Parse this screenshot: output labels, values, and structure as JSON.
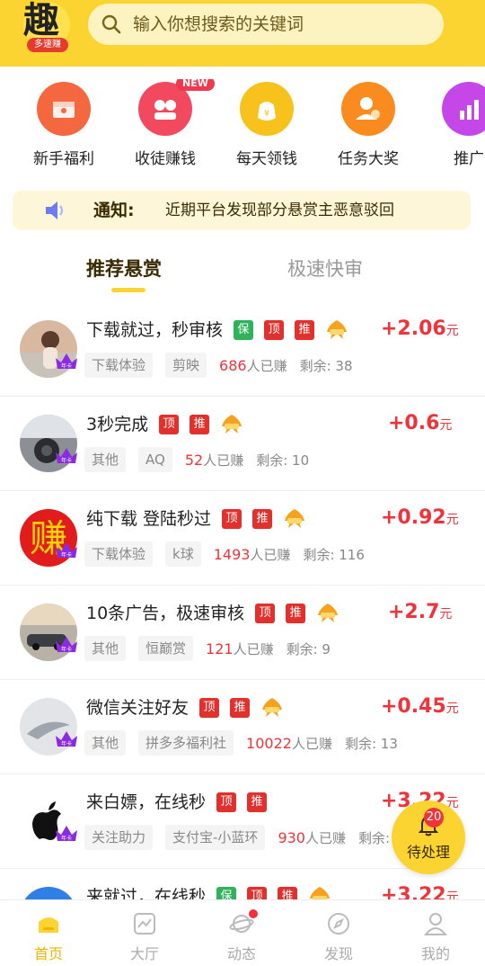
{
  "header": {
    "logo_char": "趣",
    "logo_sub": "多速赚",
    "search_placeholder": "输入你想搜索的关键词"
  },
  "quick_menu": [
    {
      "label": "新手福利",
      "icon": "gift-envelope-icon",
      "color": "#f5673e"
    },
    {
      "label": "收徒赚钱",
      "icon": "money-people-icon",
      "color": "#f2495e",
      "badge": "NEW"
    },
    {
      "label": "每天领钱",
      "icon": "money-bag-icon",
      "color": "#f8c21c"
    },
    {
      "label": "任务大奖",
      "icon": "reward-person-icon",
      "color": "#fa8c1f"
    },
    {
      "label": "推广",
      "icon": "promotion-chart-icon",
      "color": "#c647e8"
    }
  ],
  "notice": {
    "title": "通知:",
    "text": "近期平台发现部分悬赏主恶意驳回"
  },
  "tabs": {
    "active": "推荐悬赏",
    "inactive": "极速快审"
  },
  "tag_labels": {
    "bao": "保",
    "top": "顶",
    "rec": "推"
  },
  "earned_suffix": "人已赚",
  "remain_prefix": "剩余: ",
  "tasks": [
    {
      "title": "下载就过，秒审核",
      "tags": [
        "bao",
        "top",
        "rec",
        "hot"
      ],
      "amount": "+2.06",
      "unit": "元",
      "chips": [
        "下载体验",
        "剪映"
      ],
      "earned": "686",
      "remain": "38",
      "avatar": "photo-girl"
    },
    {
      "title": "3秒完成",
      "tags": [
        "top",
        "rec",
        "hot"
      ],
      "amount": "+0.6",
      "unit": "元",
      "chips": [
        "其他",
        "AQ"
      ],
      "earned": "52",
      "remain": "10",
      "avatar": "car-interior"
    },
    {
      "title": "纯下载  登陆秒过",
      "tags": [
        "top",
        "rec",
        "hot"
      ],
      "amount": "+0.92",
      "unit": "元",
      "chips": [
        "下载体验",
        "k球"
      ],
      "earned": "1493",
      "remain": "116",
      "avatar": "zhuan-char"
    },
    {
      "title": "10条广告，极速审核",
      "tags": [
        "top",
        "rec",
        "hot"
      ],
      "amount": "+2.7",
      "unit": "元",
      "chips": [
        "其他",
        "恒巅赏"
      ],
      "earned": "121",
      "remain": "9",
      "avatar": "car-photo"
    },
    {
      "title": "微信关注好友",
      "tags": [
        "top",
        "rec",
        "hot"
      ],
      "amount": "+0.45",
      "unit": "元",
      "chips": [
        "其他",
        "拼多多福利社"
      ],
      "earned": "10022",
      "remain": "13",
      "avatar": "shark-photo"
    },
    {
      "title": "来白嫖，在线秒",
      "tags": [
        "top",
        "rec"
      ],
      "amount": "+3.22",
      "unit": "元",
      "chips": [
        "关注助力",
        "支付宝-小蓝环"
      ],
      "earned": "930",
      "remain": "",
      "avatar": "apple-logo"
    },
    {
      "title": "来就过，在线秒",
      "tags": [
        "bao",
        "top",
        "rec",
        "hot"
      ],
      "amount": "+3.22",
      "unit": "元",
      "chips": [],
      "earned": "",
      "remain": "",
      "avatar": "blue-circle"
    }
  ],
  "avatar_badge": "年卡",
  "pending": {
    "count": "20",
    "label": "待处理"
  },
  "bottom_nav": [
    {
      "label": "首页",
      "icon": "home-icon",
      "active": true
    },
    {
      "label": "大厅",
      "icon": "hall-icon",
      "active": false
    },
    {
      "label": "动态",
      "icon": "planet-icon",
      "active": false,
      "dot": true
    },
    {
      "label": "发现",
      "icon": "compass-icon",
      "active": false
    },
    {
      "label": "我的",
      "icon": "profile-icon",
      "active": false
    }
  ],
  "colors": {
    "accent": "#fcd431",
    "price": "#f0333a",
    "tag_red": "#e2302c",
    "tag_green": "#2fb25a"
  }
}
